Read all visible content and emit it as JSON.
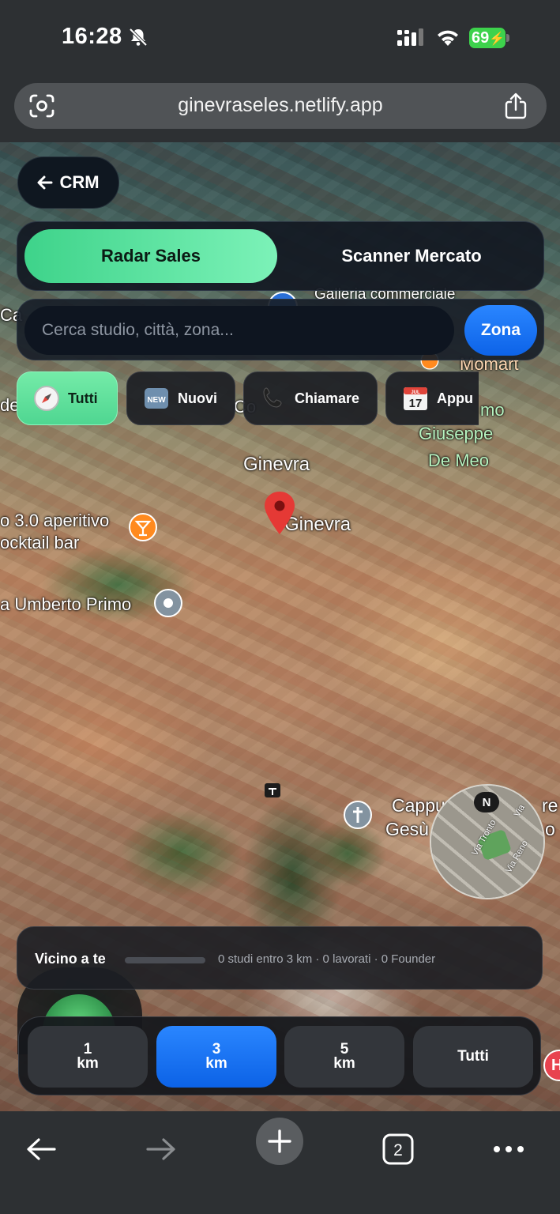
{
  "status": {
    "time": "16:28",
    "battery": "69"
  },
  "browser": {
    "url": "ginevraseles.netlify.app",
    "tabs_count": "2"
  },
  "crm": {
    "label": "CRM"
  },
  "mode_tabs": [
    {
      "label": "Radar Sales",
      "active": true
    },
    {
      "label": "Scanner Mercato",
      "active": false
    }
  ],
  "search": {
    "placeholder": "Cerca studio, città, zona...",
    "button": "Zona"
  },
  "filters": [
    {
      "label": "Tutti",
      "icon": "compass-icon",
      "active": true
    },
    {
      "label": "Nuovi",
      "icon": "new-icon",
      "active": false
    },
    {
      "label": "Chiamare",
      "icon": "phone-icon",
      "active": false
    },
    {
      "label": "Appu",
      "icon": "calendar-icon",
      "active": false
    }
  ],
  "calendar": {
    "day": "17",
    "month": "JUL"
  },
  "new_badge": "NEW",
  "map_labels": {
    "ginevra_top": "Ginevra",
    "ginevra_pin": "Ginevra",
    "aperitivo_1": "o 3.0 aperitivo",
    "aperitivo_2": "ocktail bar",
    "umberto": "a Umberto Primo",
    "galleria": "Galleria commerciale",
    "momart": "Momart",
    "giuseppe_1": "mo",
    "giuseppe_2": "Giuseppe",
    "giuseppe_3": "De Meo",
    "cappuccini_1": "Cappu",
    "cappuccini_2": "Gesù",
    "cappuccini_1b": "re",
    "cappuccini_2b": "o",
    "left_edge_1": "Ca",
    "left_edge_2": "de",
    "co": "Co"
  },
  "compass": {
    "north": "N",
    "road_1": "Via Tronto",
    "road_2": "Via Reno",
    "road_3": "Via"
  },
  "near": {
    "title": "Vicino a te",
    "stats": "0 studi entro 3 km · 0 lavorati · 0 Founder",
    "progress": 0
  },
  "range": [
    {
      "value": "1",
      "unit": "km",
      "active": false
    },
    {
      "value": "3",
      "unit": "km",
      "active": true
    },
    {
      "value": "5",
      "unit": "km",
      "active": false
    },
    {
      "value": "Tutti",
      "unit": "",
      "active": false
    }
  ],
  "edge_badge": "H",
  "colors": {
    "accent_green": "#4fd691",
    "accent_blue": "#0d63e8",
    "pin_red": "#e53935"
  }
}
